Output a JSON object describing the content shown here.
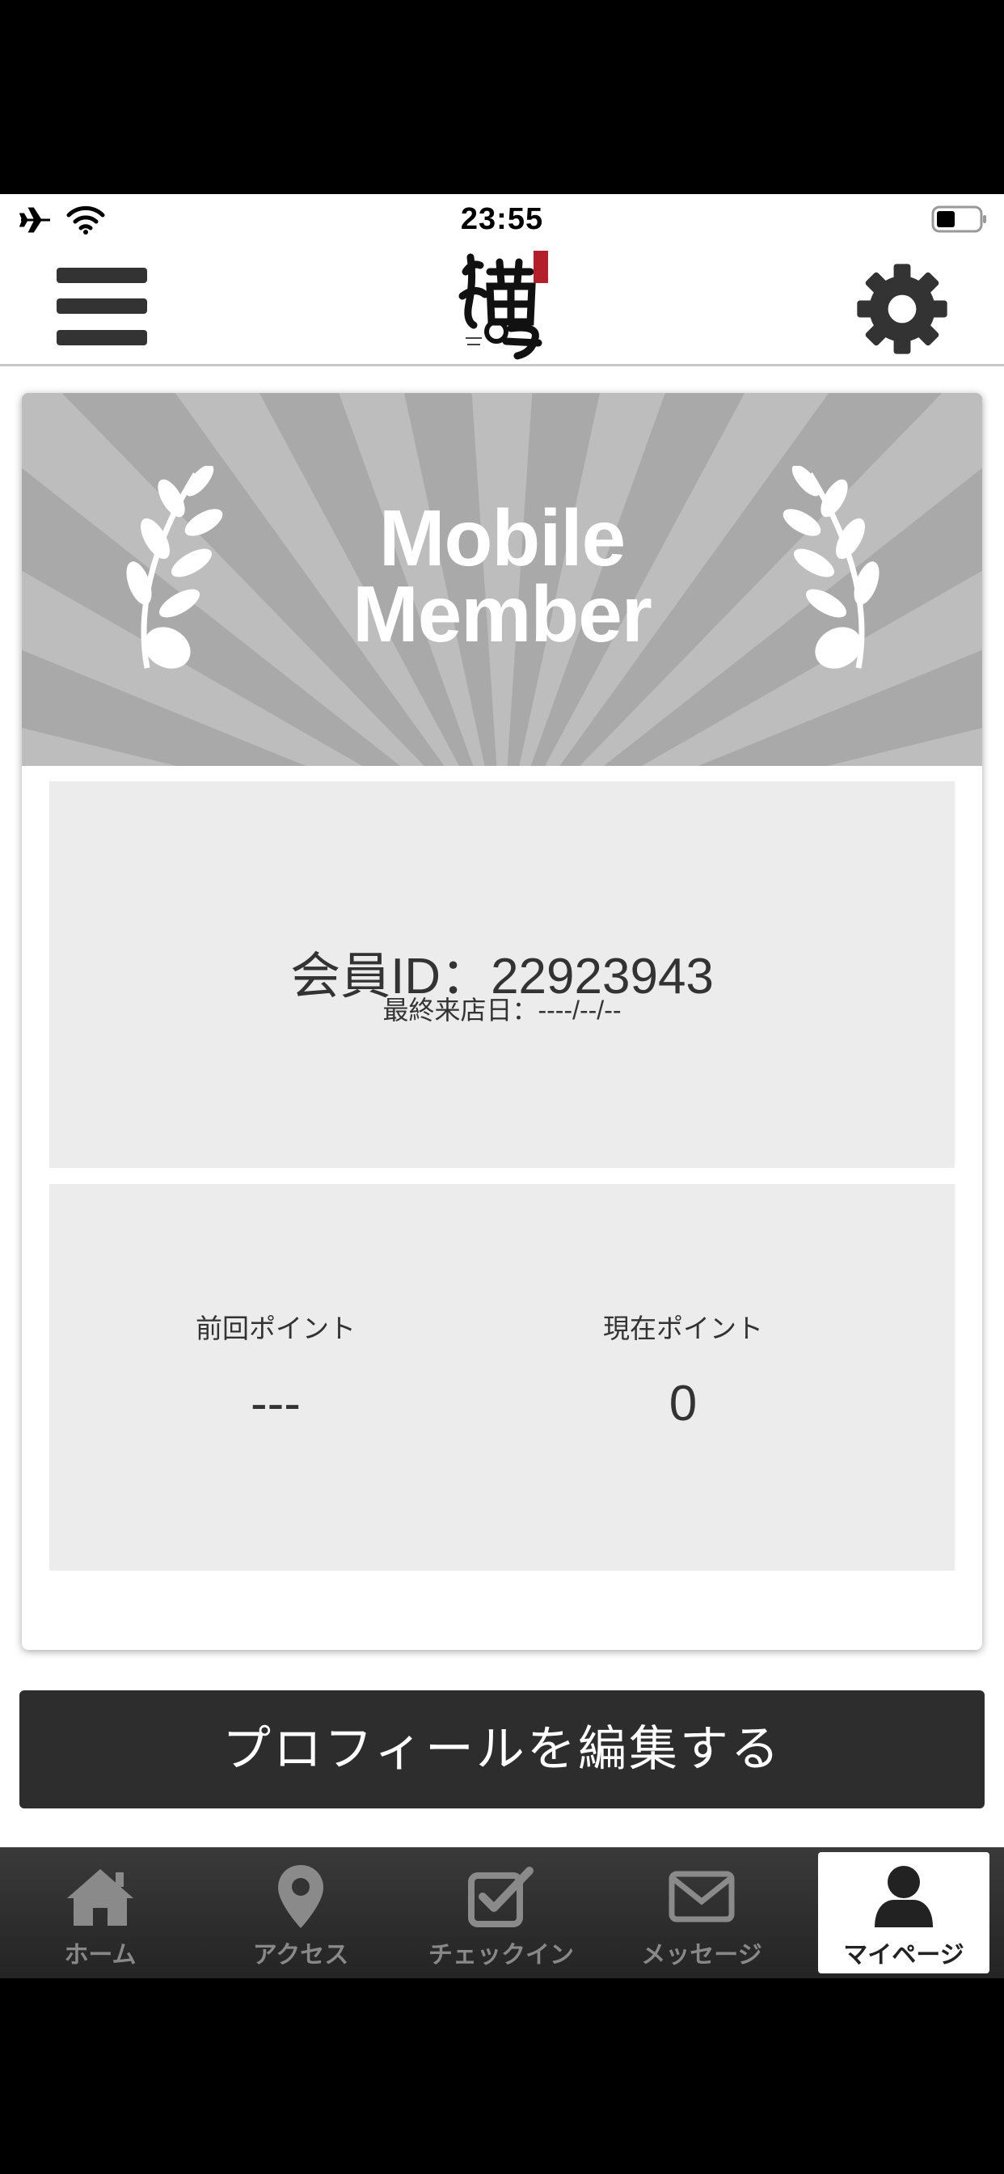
{
  "status_bar": {
    "time": "23:55",
    "icons": [
      "airplane-icon",
      "wifi-icon",
      "battery-icon"
    ]
  },
  "header": {
    "logo_icon": "nekonote-logo",
    "menu_icon": "hamburger-menu-icon",
    "settings_icon": "gear-icon"
  },
  "banner": {
    "title_line1": "Mobile",
    "title_line2": "Member"
  },
  "member": {
    "id_text": "会員ID：22923943",
    "last_visit": "最終来店日：----/--/--"
  },
  "points": {
    "previous_label": "前回ポイント",
    "previous_value": "---",
    "current_label": "現在ポイント",
    "current_value": "0"
  },
  "edit_button": "プロフィールを編集する",
  "tabs": [
    {
      "label": "ホーム",
      "icon": "home-icon"
    },
    {
      "label": "アクセス",
      "icon": "map-pin-icon"
    },
    {
      "label": "チェックイン",
      "icon": "checkbox-icon"
    },
    {
      "label": "メッセージ",
      "icon": "envelope-icon"
    },
    {
      "label": "マイページ",
      "icon": "user-icon",
      "active": true
    }
  ],
  "colors": {
    "banner_gray": "#a9a9a9",
    "panel_gray": "#ececec",
    "button_dark": "#2d2d2d",
    "tabbar_dark": "#2e2e2e"
  }
}
